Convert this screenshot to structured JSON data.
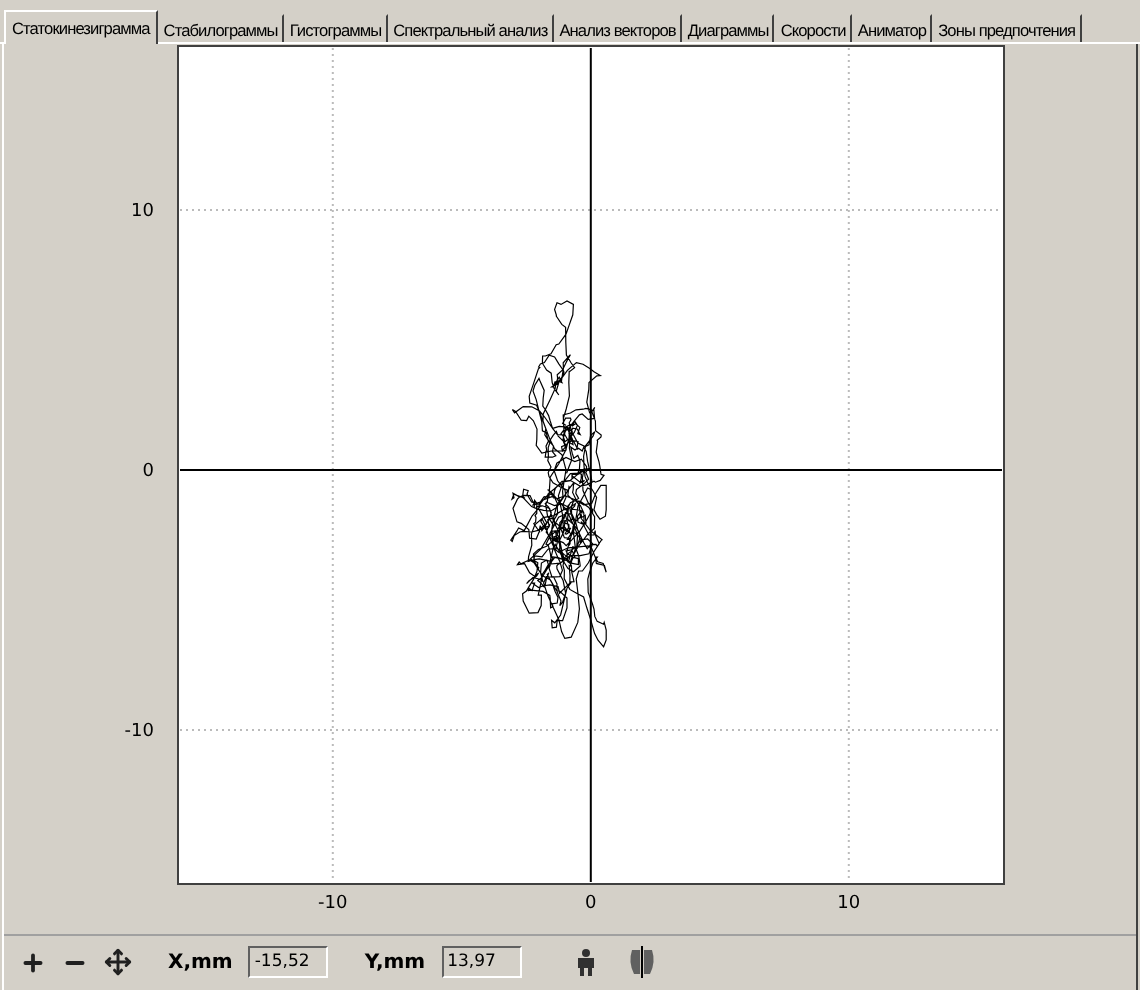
{
  "tabs": [
    {
      "label": "Статокинезиграмма",
      "selected": true
    },
    {
      "label": "Стабилограммы",
      "selected": false
    },
    {
      "label": "Гистограммы",
      "selected": false
    },
    {
      "label": "Спектральный анализ",
      "selected": false
    },
    {
      "label": "Анализ векторов",
      "selected": false
    },
    {
      "label": "Диаграммы",
      "selected": false
    },
    {
      "label": "Скорости",
      "selected": false
    },
    {
      "label": "Аниматор",
      "selected": false
    },
    {
      "label": "Зоны предпочтения",
      "selected": false
    }
  ],
  "plot": {
    "x_tick_labels": [
      "-10",
      "0",
      "10"
    ],
    "y_tick_labels": [
      "10",
      "0",
      "-10"
    ]
  },
  "toolbar": {
    "x_label": "X,mm",
    "x_value": "-15,52",
    "y_label": "Y,mm",
    "y_value": "13,97"
  }
}
